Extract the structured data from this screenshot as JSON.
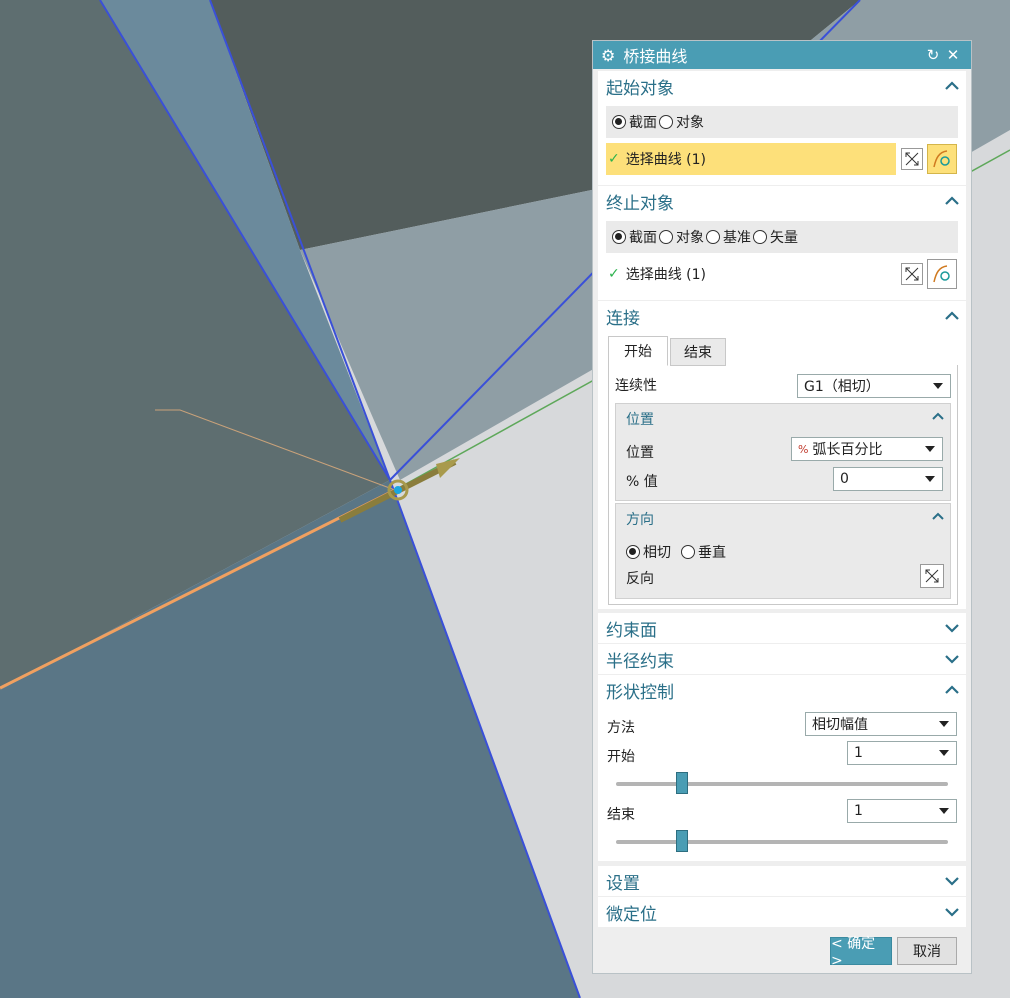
{
  "dialog": {
    "title": "桥接曲线",
    "title_icon": "gear-icon",
    "reset_icon": "reset-icon",
    "close_icon": "close-icon"
  },
  "start_object": {
    "header": "起始对象",
    "radio_section": "截面",
    "radio_object": "对象",
    "select_curve": "选择曲线 (1)"
  },
  "end_object": {
    "header": "终止对象",
    "radio_section": "截面",
    "radio_object": "对象",
    "radio_datum": "基准",
    "radio_vector": "矢量",
    "select_curve": "选择曲线 (1)"
  },
  "connect": {
    "header": "连接",
    "tab_start": "开始",
    "tab_end": "结束",
    "continuity_label": "连续性",
    "continuity_value": "G1（相切）",
    "position": {
      "header": "位置",
      "position_label": "位置",
      "position_value": "弧长百分比",
      "percent_label": "% 值",
      "percent_value": "0"
    },
    "direction": {
      "header": "方向",
      "radio_tangent": "相切",
      "radio_normal": "垂直",
      "reverse_label": "反向"
    }
  },
  "constraint_face": {
    "header": "约束面"
  },
  "radius_constraint": {
    "header": "半径约束"
  },
  "shape_control": {
    "header": "形状控制",
    "method_label": "方法",
    "method_value": "相切幅值",
    "start_label": "开始",
    "start_value": "1",
    "start_slider_fraction": 0.2,
    "end_label": "结束",
    "end_value": "1",
    "end_slider_fraction": 0.2
  },
  "settings": {
    "header": "设置"
  },
  "fine_position": {
    "header": "微定位"
  },
  "footer": {
    "ok": "< 确定 >",
    "cancel": "取消"
  },
  "colors": {
    "accent": "#4a9db4",
    "highlight_row": "#fde07a",
    "section_text": "#2a6f88"
  }
}
